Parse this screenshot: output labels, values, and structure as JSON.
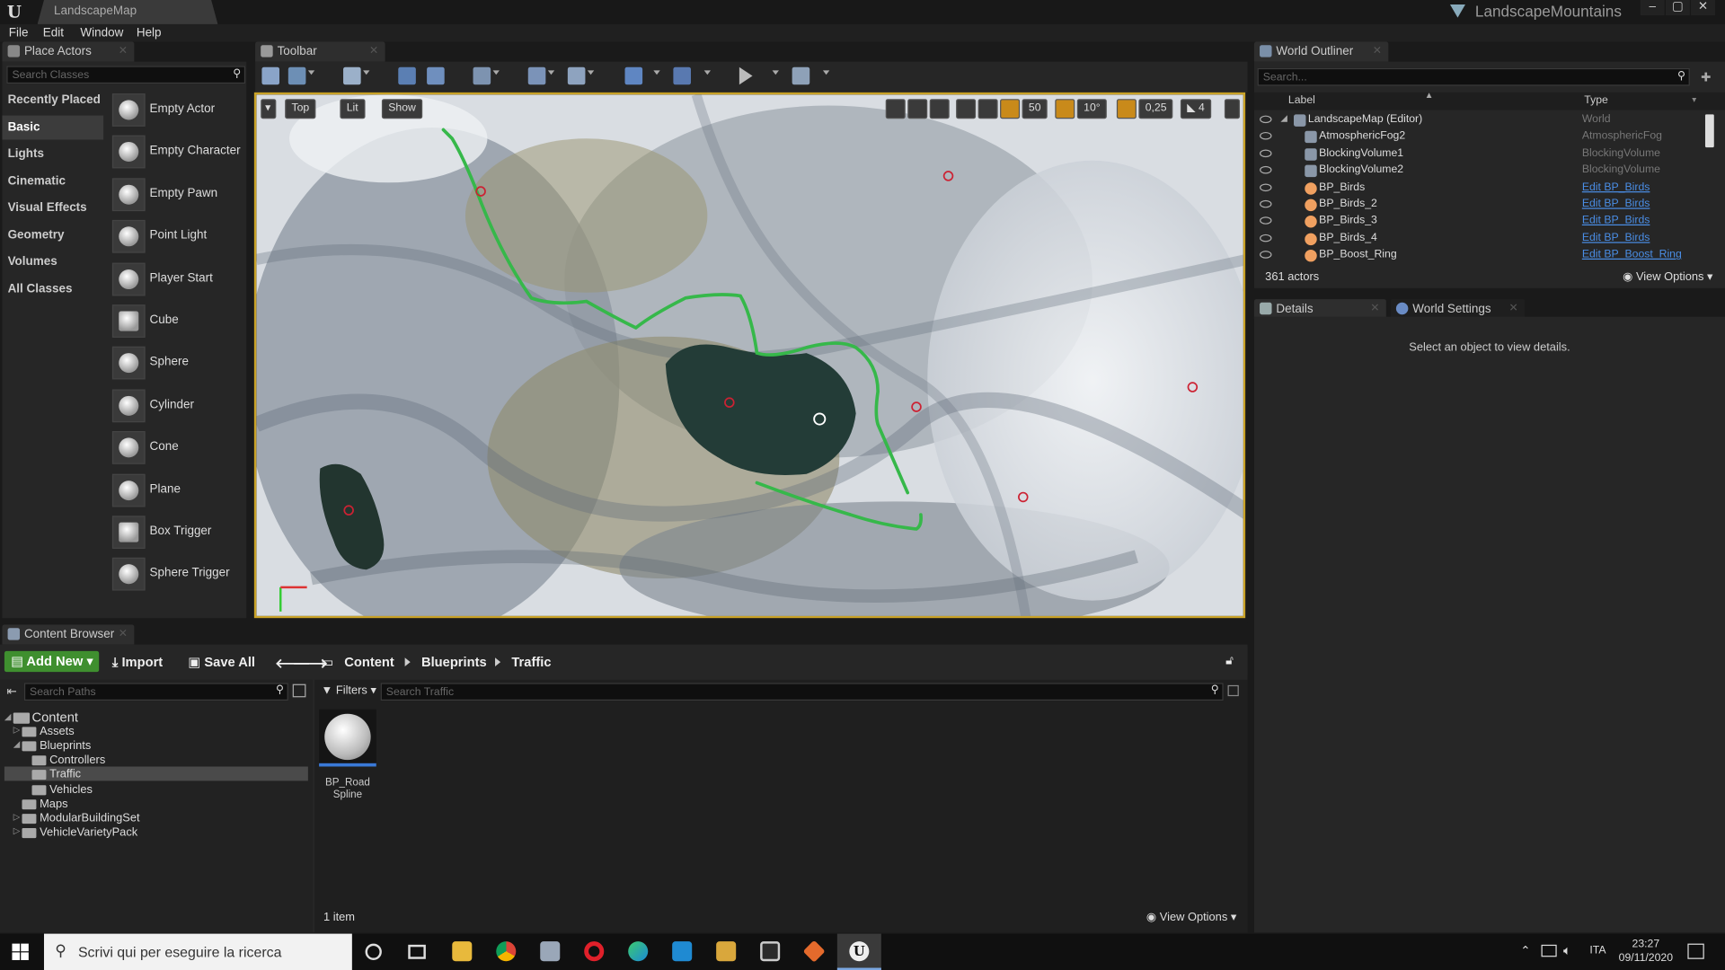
{
  "window": {
    "tab": "LandscapeMap",
    "project": "LandscapeMountains",
    "min": "–",
    "max": "▢",
    "close": "✕"
  },
  "menu": [
    "File",
    "Edit",
    "Window",
    "Help"
  ],
  "place_actors": {
    "tab": "Place Actors",
    "search_placeholder": "Search Classes",
    "categories": [
      "Recently Placed",
      "Basic",
      "Lights",
      "Cinematic",
      "Visual Effects",
      "Geometry",
      "Volumes",
      "All Classes"
    ],
    "active_category": "Basic",
    "actors": [
      "Empty Actor",
      "Empty Character",
      "Empty Pawn",
      "Point Light",
      "Player Start",
      "Cube",
      "Sphere",
      "Cylinder",
      "Cone",
      "Plane",
      "Box Trigger",
      "Sphere Trigger"
    ]
  },
  "toolbar": {
    "tab": "Toolbar"
  },
  "viewport": {
    "view_mode": "Top",
    "lit": "Lit",
    "show": "Show",
    "grid_snap": "50",
    "rotation_snap": "10°",
    "scale_snap": "0,25",
    "camera_speed": "4"
  },
  "outliner": {
    "tab": "World Outliner",
    "search_placeholder": "Search...",
    "col_label": "Label",
    "col_type": "Type",
    "rows": [
      {
        "label": "LandscapeMap (Editor)",
        "type": "World",
        "link": false
      },
      {
        "label": "AtmosphericFog2",
        "type": "AtmosphericFog",
        "link": false
      },
      {
        "label": "BlockingVolume1",
        "type": "BlockingVolume",
        "link": false
      },
      {
        "label": "BlockingVolume2",
        "type": "BlockingVolume",
        "link": false
      },
      {
        "label": "BP_Birds",
        "type": "Edit BP_Birds",
        "link": true
      },
      {
        "label": "BP_Birds_2",
        "type": "Edit BP_Birds",
        "link": true
      },
      {
        "label": "BP_Birds_3",
        "type": "Edit BP_Birds",
        "link": true
      },
      {
        "label": "BP_Birds_4",
        "type": "Edit BP_Birds",
        "link": true
      },
      {
        "label": "BP_Boost_Ring",
        "type": "Edit BP_Boost_Ring",
        "link": true
      }
    ],
    "count": "361 actors",
    "view_options": "View Options"
  },
  "details": {
    "tab": "Details",
    "tab2": "World Settings",
    "empty_msg": "Select an object to view details."
  },
  "content_browser": {
    "tab": "Content Browser",
    "add_new": "Add New",
    "import": "Import",
    "save_all": "Save All",
    "breadcrumb": [
      "Content",
      "Blueprints",
      "Traffic"
    ],
    "search_paths_placeholder": "Search Paths",
    "filters": "Filters",
    "search_placeholder": "Search Traffic",
    "tree": [
      {
        "label": "Content",
        "indent": 0,
        "root": true
      },
      {
        "label": "Assets",
        "indent": 1
      },
      {
        "label": "Blueprints",
        "indent": 1
      },
      {
        "label": "Controllers",
        "indent": 2
      },
      {
        "label": "Traffic",
        "indent": 2,
        "selected": true
      },
      {
        "label": "Vehicles",
        "indent": 2
      },
      {
        "label": "Maps",
        "indent": 1
      },
      {
        "label": "ModularBuildingSet",
        "indent": 1
      },
      {
        "label": "VehicleVarietyPack",
        "indent": 1
      }
    ],
    "asset_line1": "BP_Road",
    "asset_line2": "Spline",
    "item_count": "1 item",
    "view_options": "View Options"
  },
  "taskbar": {
    "search": "Scrivi qui per eseguire la ricerca",
    "lang": "ITA",
    "time": "23:27",
    "date": "09/11/2020"
  },
  "colors": {
    "accent_green": "#3f8f2f",
    "viewport_border": "#c9a227",
    "link": "#4a8ee6",
    "spline": "#36b84a"
  }
}
